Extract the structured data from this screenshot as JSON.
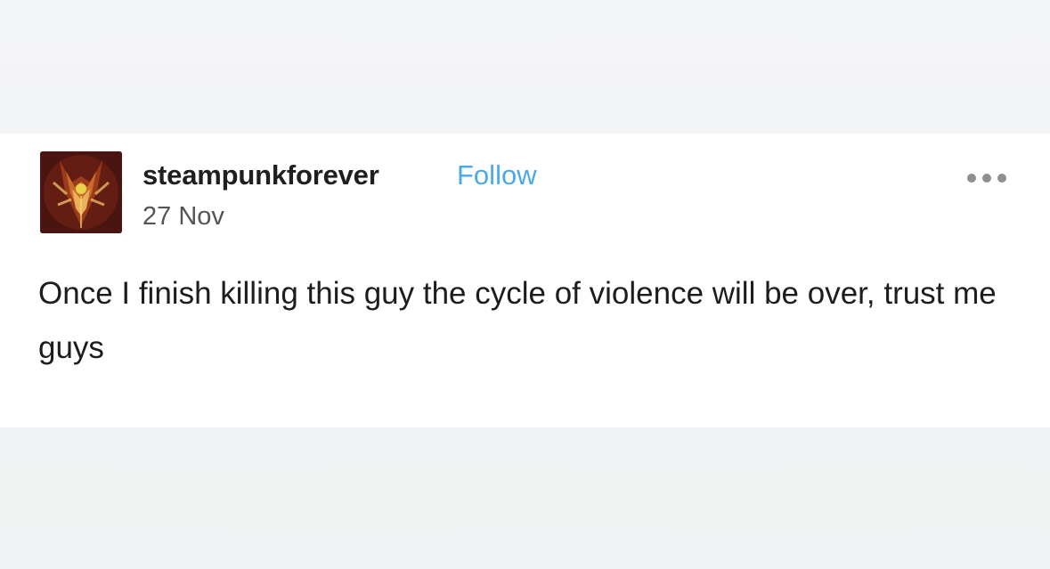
{
  "post": {
    "author": {
      "username": "steampunkforever",
      "follow_label": "Follow",
      "avatar_icon": "steampunk-wolf-avatar"
    },
    "date": "27 Nov",
    "more_icon": "more-options-icon",
    "text": "Once I finish killing this guy the cycle of violence will be over, trust me guys"
  },
  "colors": {
    "follow": "#4aa9ea",
    "text": "#1d1d1d",
    "background": "#ffffff"
  }
}
